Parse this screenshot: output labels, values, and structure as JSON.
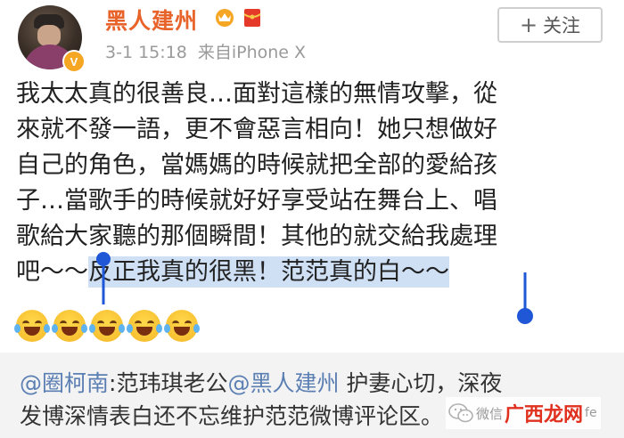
{
  "post": {
    "username": "黑人建州",
    "timestamp": "3-1 15:18",
    "source": "来自iPhone X",
    "follow_label": "关注",
    "body_lines": [
      "我太太真的很善良…面對這樣的無情攻擊，從",
      "來就不發一語，更不會惡言相向！她只想做好",
      "自己的角色，當媽媽的時候就把全部的愛給孩",
      "子…當歌手的時候就好好享受站在舞台上、唱",
      "歌給大家聽的那個瞬間！其他的就交給我處理"
    ],
    "last_line_prefix": "吧～～",
    "last_line_highlight": "反正我真的很黑！范范真的白～～",
    "emoji_count": 5,
    "badge_label": "V"
  },
  "comment": {
    "mention": "@圈柯南",
    "line1_a": ":范玮琪老公",
    "mention2": "@黑人建州",
    "line1_b": " 护妻心切，深夜",
    "line2": "发博深情表白还不忘维护范范微博评论区。"
  },
  "watermark": {
    "text1": "微信",
    "logo": "广西龙网",
    "tail": "fe"
  },
  "colors": {
    "username": "#e8632a",
    "highlight": "#cfe0f5",
    "selection_handle": "#1f57d6",
    "mention": "#5b7fb3",
    "watermark_logo": "#e0301e"
  }
}
